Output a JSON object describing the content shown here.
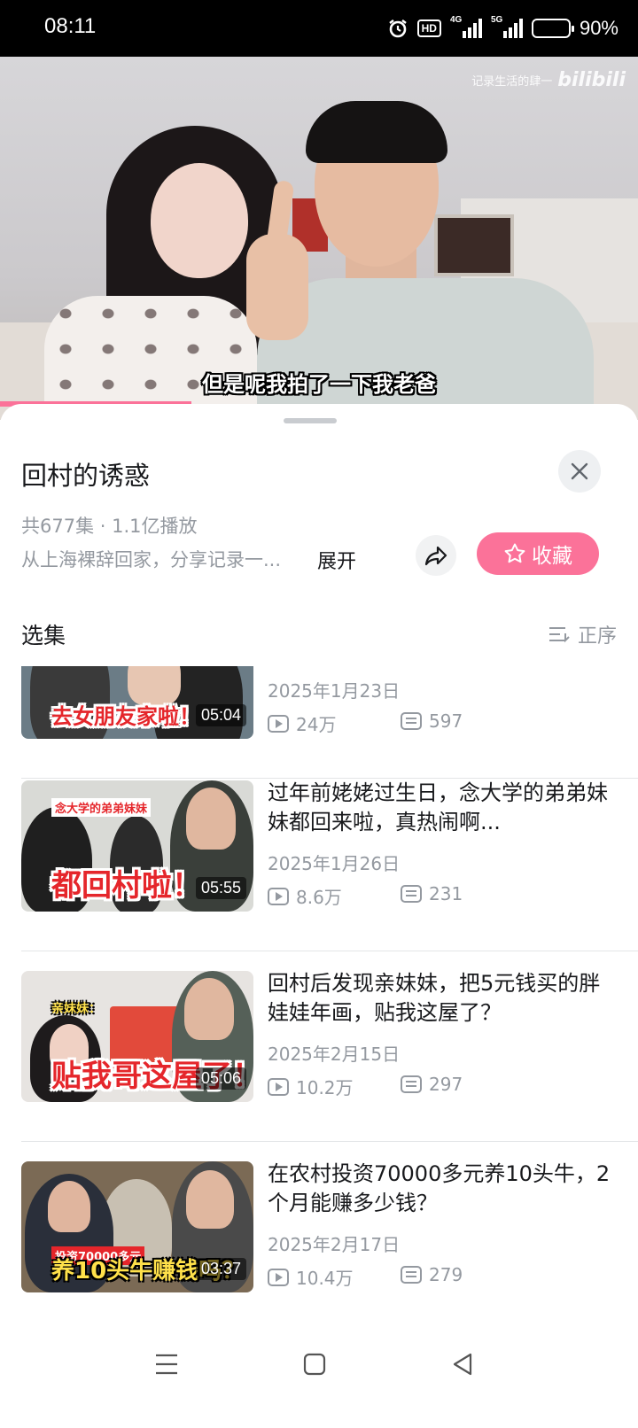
{
  "status_bar": {
    "time": "08:11",
    "network_hd": "HD",
    "sig1_label": "4G",
    "sig2_label": "5G",
    "battery": "90%",
    "battery_level": 0.9
  },
  "video": {
    "watermark": "记录生活的肆一",
    "watermark_logo": "bilibili",
    "subtitle": "但是呢我拍了一下我老爸",
    "progress": 0.3
  },
  "collection": {
    "title": "回村的诱惑",
    "meta": "共677集 · 1.1亿播放",
    "description": "从上海裸辞回家，分享记录一...",
    "expand_label": "展开",
    "favorite_label": "收藏",
    "section_label": "选集",
    "order_label": "正序"
  },
  "episodes": [
    {
      "date": "2025年1月23日",
      "views": "24万",
      "danmaku": "597",
      "duration": "05:04",
      "caption": "去女朋友家啦！"
    },
    {
      "title": "过年前姥姥过生日，念大学的弟弟妹妹都回来啦，真热闹啊...",
      "date": "2025年1月26日",
      "views": "8.6万",
      "danmaku": "231",
      "duration": "05:55",
      "caption": "都回村啦！",
      "tag": "念大学的弟弟妹妹"
    },
    {
      "title": "回村后发现亲妹妹，把5元钱买的胖娃娃年画，贴我这屋了？",
      "date": "2025年2月15日",
      "views": "10.2万",
      "danmaku": "297",
      "duration": "05:06",
      "caption": "贴我哥这屋了！",
      "tag": "亲妹妹："
    },
    {
      "title": "在农村投资70000多元养10头牛，2个月能赚多少钱？",
      "date": "2025年2月17日",
      "views": "10.4万",
      "danmaku": "279",
      "duration": "03:37",
      "caption": "养10头牛赚钱吗？",
      "tag": "投资70000多元"
    }
  ],
  "icons": {
    "close": "close-icon",
    "share": "share-icon",
    "favorite": "star-icon",
    "order": "sort-icon",
    "views": "play-count-icon",
    "danmaku": "danmaku-icon",
    "nav_menu": "menu-icon",
    "nav_home": "home-icon",
    "nav_back": "back-icon"
  },
  "colors": {
    "accent": "#fb7299",
    "secondary_text": "#9499a0",
    "primary_text": "#18191c"
  }
}
